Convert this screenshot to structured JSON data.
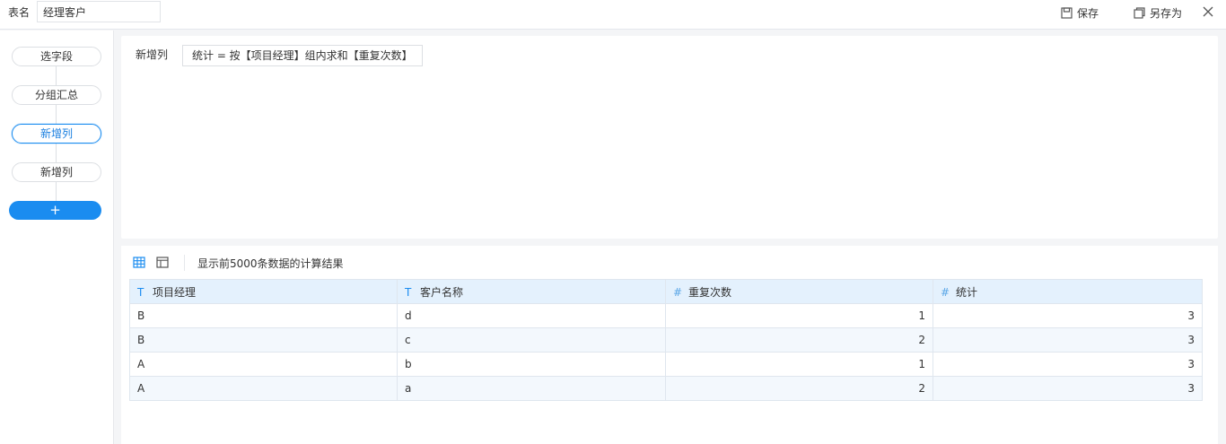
{
  "topbar": {
    "name_label": "表名",
    "name_value": "经理客户",
    "save_label": "保存",
    "save_as_label": "另存为"
  },
  "steps": [
    {
      "label": "选字段",
      "active": false
    },
    {
      "label": "分组汇总",
      "active": false
    },
    {
      "label": "新增列",
      "active": true
    },
    {
      "label": "新增列",
      "active": false
    }
  ],
  "add_step_label": "+",
  "config": {
    "label": "新增列",
    "formula": "统计 = 按【项目经理】组内求和【重复次数】"
  },
  "result": {
    "note": "显示前5000条数据的计算结果",
    "columns": [
      {
        "type": "T",
        "name": "项目经理"
      },
      {
        "type": "T",
        "name": "客户名称"
      },
      {
        "type": "#",
        "name": "重复次数"
      },
      {
        "type": "#",
        "name": "统计"
      }
    ],
    "rows": [
      [
        "B",
        "d",
        "1",
        "3"
      ],
      [
        "B",
        "c",
        "2",
        "3"
      ],
      [
        "A",
        "b",
        "1",
        "3"
      ],
      [
        "A",
        "a",
        "2",
        "3"
      ]
    ]
  },
  "colors": {
    "accent": "#1a8cf0",
    "header_bg": "#e4f1fd",
    "alt_row_bg": "#f3f8fd"
  },
  "icons": {
    "save": "floppy-icon",
    "save_as": "copy-save-icon",
    "close": "close-icon",
    "grid_view": "grid-icon",
    "panel_view": "panel-icon"
  }
}
